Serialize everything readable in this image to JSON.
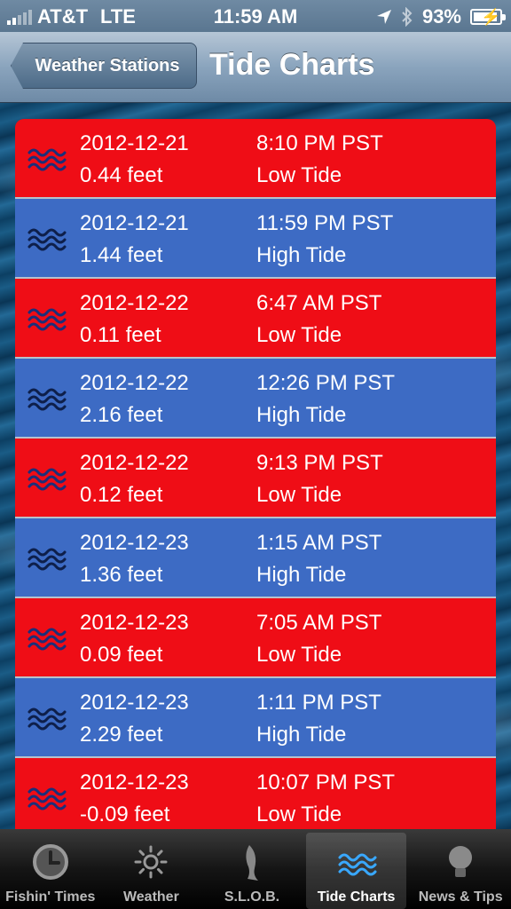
{
  "status_bar": {
    "carrier": "AT&T",
    "network": "LTE",
    "time": "11:59 AM",
    "battery": "93%",
    "battery_level": 0.93
  },
  "nav": {
    "back_label": "Weather Stations",
    "title": "Tide Charts"
  },
  "colors": {
    "low_tide": "#ef0d16",
    "high_tide": "#3d6bc4"
  },
  "tides": [
    {
      "date": "2012-12-21",
      "height": "0.44 feet",
      "time": "8:10 PM PST",
      "type": "Low Tide",
      "kind": "low"
    },
    {
      "date": "2012-12-21",
      "height": "1.44 feet",
      "time": "11:59 PM PST",
      "type": "High Tide",
      "kind": "high"
    },
    {
      "date": "2012-12-22",
      "height": "0.11 feet",
      "time": "6:47 AM PST",
      "type": "Low Tide",
      "kind": "low"
    },
    {
      "date": "2012-12-22",
      "height": "2.16 feet",
      "time": "12:26 PM PST",
      "type": "High Tide",
      "kind": "high"
    },
    {
      "date": "2012-12-22",
      "height": "0.12 feet",
      "time": "9:13 PM PST",
      "type": "Low Tide",
      "kind": "low"
    },
    {
      "date": "2012-12-23",
      "height": "1.36 feet",
      "time": "1:15 AM PST",
      "type": "High Tide",
      "kind": "high"
    },
    {
      "date": "2012-12-23",
      "height": "0.09 feet",
      "time": "7:05 AM PST",
      "type": "Low Tide",
      "kind": "low"
    },
    {
      "date": "2012-12-23",
      "height": "2.29 feet",
      "time": "1:11 PM PST",
      "type": "High Tide",
      "kind": "high"
    },
    {
      "date": "2012-12-23",
      "height": "-0.09 feet",
      "time": "10:07 PM PST",
      "type": "Low Tide",
      "kind": "low"
    }
  ],
  "tab_bar": [
    {
      "label": "Fishin' Times",
      "icon": "clock-icon"
    },
    {
      "label": "Weather",
      "icon": "sun-icon"
    },
    {
      "label": "S.L.O.B.",
      "icon": "fish-icon"
    },
    {
      "label": "Tide Charts",
      "icon": "waves-icon",
      "active": true
    },
    {
      "label": "News & Tips",
      "icon": "lightbulb-icon"
    }
  ]
}
